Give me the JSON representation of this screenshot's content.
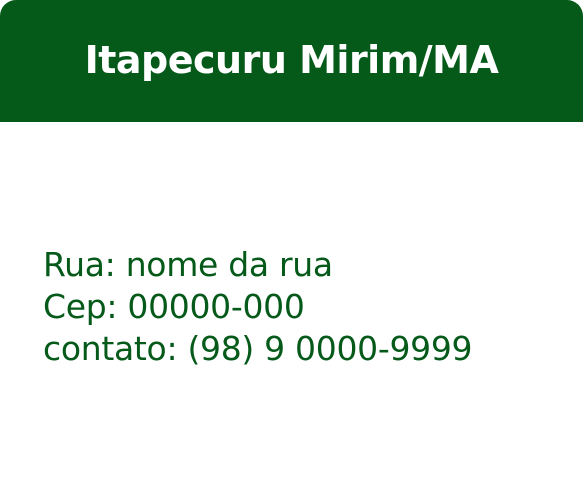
{
  "card": {
    "title": "Itapecuru Mirim/MA",
    "address_line": "Rua: nome da rua",
    "cep_line": "Cep: 00000-000",
    "contact_line": "contato: (98) 9 0000-9999"
  },
  "colors": {
    "header_background": "#055a1a",
    "title_text": "#ffffff",
    "body_text": "#055a1a",
    "card_background": "#ffffff"
  }
}
